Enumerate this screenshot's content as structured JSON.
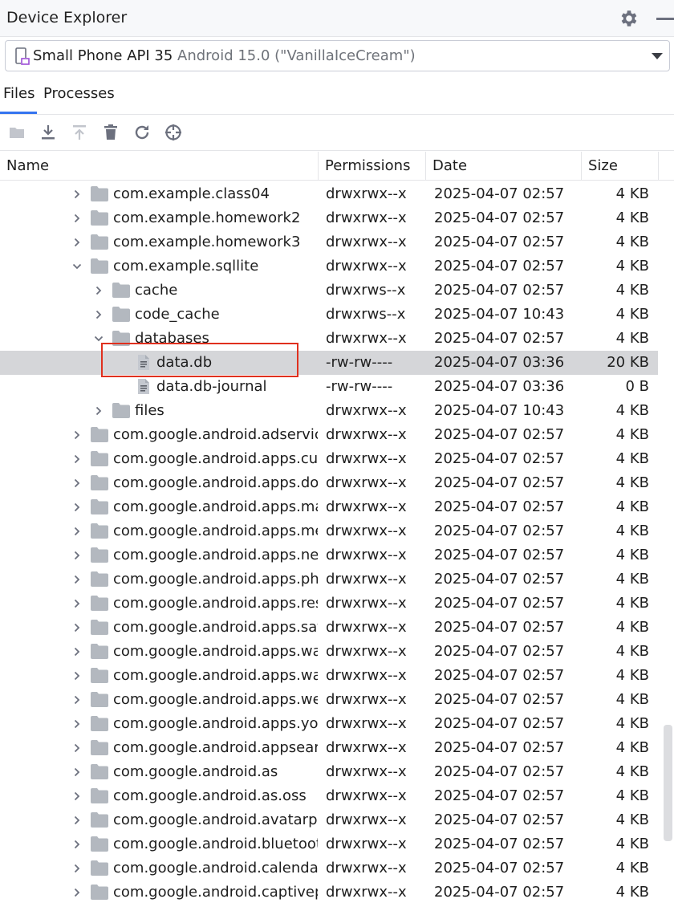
{
  "window": {
    "title": "Device Explorer"
  },
  "device": {
    "name": "Small Phone API 35",
    "subtitle": "Android 15.0 (\"VanillaIceCream\")"
  },
  "tabs": [
    {
      "label": "Files",
      "active": true
    },
    {
      "label": "Processes",
      "active": false
    }
  ],
  "toolbar": {
    "icons": [
      "new-folder-icon",
      "download-icon",
      "upload-icon",
      "delete-icon",
      "refresh-icon",
      "locate-icon"
    ]
  },
  "columns": {
    "name": "Name",
    "permissions": "Permissions",
    "date": "Date",
    "size": "Size"
  },
  "rows": [
    {
      "name": "com.example.class04",
      "perm": "drwxrwx--x",
      "date": "2025-04-07 02:57",
      "size": "4 KB",
      "depth": 0,
      "type": "folder",
      "expanded": false
    },
    {
      "name": "com.example.homework2",
      "perm": "drwxrwx--x",
      "date": "2025-04-07 02:57",
      "size": "4 KB",
      "depth": 0,
      "type": "folder",
      "expanded": false
    },
    {
      "name": "com.example.homework3",
      "perm": "drwxrwx--x",
      "date": "2025-04-07 02:57",
      "size": "4 KB",
      "depth": 0,
      "type": "folder",
      "expanded": false
    },
    {
      "name": "com.example.sqllite",
      "perm": "drwxrwx--x",
      "date": "2025-04-07 02:57",
      "size": "4 KB",
      "depth": 0,
      "type": "folder",
      "expanded": true
    },
    {
      "name": "cache",
      "perm": "drwxrws--x",
      "date": "2025-04-07 02:57",
      "size": "4 KB",
      "depth": 1,
      "type": "folder",
      "expanded": false
    },
    {
      "name": "code_cache",
      "perm": "drwxrws--x",
      "date": "2025-04-07 10:43",
      "size": "4 KB",
      "depth": 1,
      "type": "folder",
      "expanded": false
    },
    {
      "name": "databases",
      "perm": "drwxrwx--x",
      "date": "2025-04-07 02:57",
      "size": "4 KB",
      "depth": 1,
      "type": "folder",
      "expanded": true
    },
    {
      "name": "data.db",
      "perm": "-rw-rw----",
      "date": "2025-04-07 03:36",
      "size": "20 KB",
      "depth": 2,
      "type": "file",
      "selected": true
    },
    {
      "name": "data.db-journal",
      "perm": "-rw-rw----",
      "date": "2025-04-07 03:36",
      "size": "0 B",
      "depth": 2,
      "type": "file"
    },
    {
      "name": "files",
      "perm": "drwxrwx--x",
      "date": "2025-04-07 10:43",
      "size": "4 KB",
      "depth": 1,
      "type": "folder",
      "expanded": false
    },
    {
      "name": "com.google.android.adservices",
      "perm": "drwxrwx--x",
      "date": "2025-04-07 02:57",
      "size": "4 KB",
      "depth": 0,
      "type": "folder",
      "expanded": false
    },
    {
      "name": "com.google.android.apps.customization",
      "perm": "drwxrwx--x",
      "date": "2025-04-07 02:57",
      "size": "4 KB",
      "depth": 0,
      "type": "folder",
      "expanded": false
    },
    {
      "name": "com.google.android.apps.docs",
      "perm": "drwxrwx--x",
      "date": "2025-04-07 02:57",
      "size": "4 KB",
      "depth": 0,
      "type": "folder",
      "expanded": false
    },
    {
      "name": "com.google.android.apps.maps",
      "perm": "drwxrwx--x",
      "date": "2025-04-07 02:57",
      "size": "4 KB",
      "depth": 0,
      "type": "folder",
      "expanded": false
    },
    {
      "name": "com.google.android.apps.messaging",
      "perm": "drwxrwx--x",
      "date": "2025-04-07 02:57",
      "size": "4 KB",
      "depth": 0,
      "type": "folder",
      "expanded": false
    },
    {
      "name": "com.google.android.apps.nexuslauncher",
      "perm": "drwxrwx--x",
      "date": "2025-04-07 02:57",
      "size": "4 KB",
      "depth": 0,
      "type": "folder",
      "expanded": false
    },
    {
      "name": "com.google.android.apps.photos",
      "perm": "drwxrwx--x",
      "date": "2025-04-07 02:57",
      "size": "4 KB",
      "depth": 0,
      "type": "folder",
      "expanded": false
    },
    {
      "name": "com.google.android.apps.restore",
      "perm": "drwxrwx--x",
      "date": "2025-04-07 02:57",
      "size": "4 KB",
      "depth": 0,
      "type": "folder",
      "expanded": false
    },
    {
      "name": "com.google.android.apps.safetyhub",
      "perm": "drwxrwx--x",
      "date": "2025-04-07 02:57",
      "size": "4 KB",
      "depth": 0,
      "type": "folder",
      "expanded": false
    },
    {
      "name": "com.google.android.apps.wallpaper",
      "perm": "drwxrwx--x",
      "date": "2025-04-07 02:57",
      "size": "4 KB",
      "depth": 0,
      "type": "folder",
      "expanded": false
    },
    {
      "name": "com.google.android.apps.walletnfcrel",
      "perm": "drwxrwx--x",
      "date": "2025-04-07 02:57",
      "size": "4 KB",
      "depth": 0,
      "type": "folder",
      "expanded": false
    },
    {
      "name": "com.google.android.apps.wellbeing",
      "perm": "drwxrwx--x",
      "date": "2025-04-07 02:57",
      "size": "4 KB",
      "depth": 0,
      "type": "folder",
      "expanded": false
    },
    {
      "name": "com.google.android.apps.youtube",
      "perm": "drwxrwx--x",
      "date": "2025-04-07 02:57",
      "size": "4 KB",
      "depth": 0,
      "type": "folder",
      "expanded": false
    },
    {
      "name": "com.google.android.appsearch",
      "perm": "drwxrwx--x",
      "date": "2025-04-07 02:57",
      "size": "4 KB",
      "depth": 0,
      "type": "folder",
      "expanded": false
    },
    {
      "name": "com.google.android.as",
      "perm": "drwxrwx--x",
      "date": "2025-04-07 02:57",
      "size": "4 KB",
      "depth": 0,
      "type": "folder",
      "expanded": false
    },
    {
      "name": "com.google.android.as.oss",
      "perm": "drwxrwx--x",
      "date": "2025-04-07 02:57",
      "size": "4 KB",
      "depth": 0,
      "type": "folder",
      "expanded": false
    },
    {
      "name": "com.google.android.avatarpicker",
      "perm": "drwxrwx--x",
      "date": "2025-04-07 02:57",
      "size": "4 KB",
      "depth": 0,
      "type": "folder",
      "expanded": false
    },
    {
      "name": "com.google.android.bluetooth",
      "perm": "drwxrwx--x",
      "date": "2025-04-07 02:57",
      "size": "4 KB",
      "depth": 0,
      "type": "folder",
      "expanded": false
    },
    {
      "name": "com.google.android.calendar",
      "perm": "drwxrwx--x",
      "date": "2025-04-07 02:57",
      "size": "4 KB",
      "depth": 0,
      "type": "folder",
      "expanded": false
    },
    {
      "name": "com.google.android.captiveportallogin",
      "perm": "drwxrwx--x",
      "date": "2025-04-07 02:57",
      "size": "4 KB",
      "depth": 0,
      "type": "folder",
      "expanded": false
    }
  ],
  "colors": {
    "selection": "#d5d6d9",
    "highlight_box": "#e0301e",
    "folder": "#b3b8bf",
    "accent": "#3574f0"
  }
}
